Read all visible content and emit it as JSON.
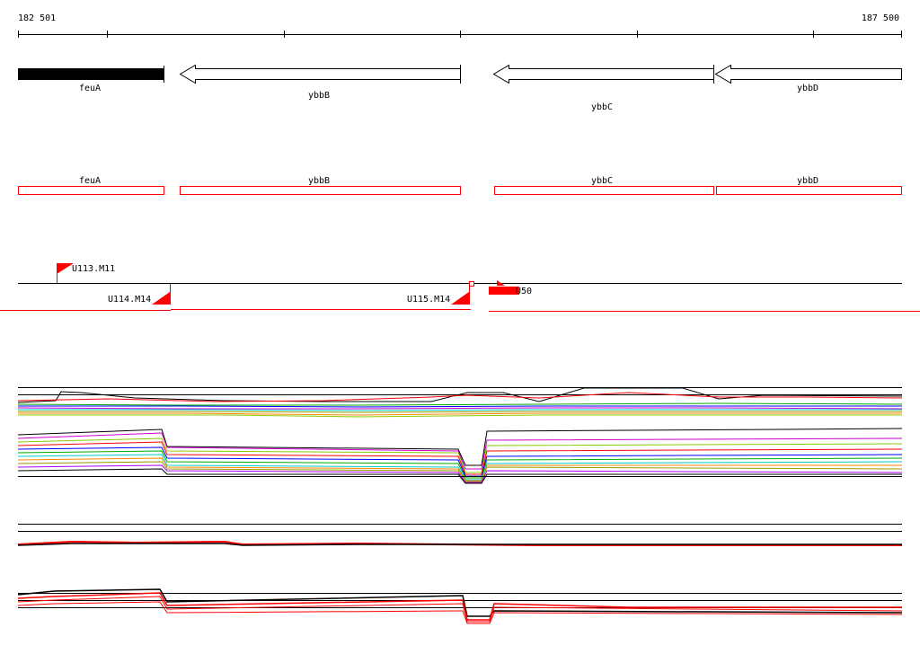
{
  "coordinates": {
    "start_label": "182 501",
    "end_label": "187 500"
  },
  "genes": [
    {
      "name": "feuA",
      "strand": "solid"
    },
    {
      "name": "ybbB",
      "strand": "-"
    },
    {
      "name": "ybbC",
      "strand": "-"
    },
    {
      "name": "ybbD",
      "strand": "-"
    }
  ],
  "annotation_track": [
    "feuA",
    "ybbB",
    "ybbC",
    "ybbD"
  ],
  "tss_labels": [
    "U113.M11",
    "U114.M14",
    "U115.M14",
    "U50"
  ],
  "colors": {
    "accent": "#ff0000",
    "line": "#000000",
    "background": "#ffffff"
  }
}
